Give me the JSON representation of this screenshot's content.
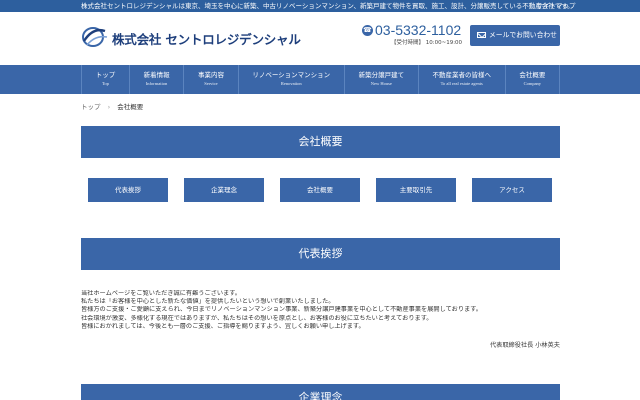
{
  "topbar": {
    "text": "株式会社セントロレジデンシャルは東京、埼玉を中心に新築、中古リノベーションマンション、新築戸建て物件を買取、施工、設計、分譲販売している不動産会社です。",
    "sitemap": "｜サイトマップ"
  },
  "header": {
    "logo_text": "株式会社 セントロレジデンシャル",
    "phone_number": "03-5332-1102",
    "phone_hours": "【受付時間】 10:00~19:00",
    "mail_button": "メールでお問い合わせ"
  },
  "colors": {
    "brand": "#3a66a8",
    "topbar": "#2d5f9e",
    "logo": "#1e3f7c"
  },
  "nav": {
    "items": [
      {
        "jp": "トップ",
        "en": "Top"
      },
      {
        "jp": "新着情報",
        "en": "Information"
      },
      {
        "jp": "事業内容",
        "en": "Service"
      },
      {
        "jp": "リノベーションマンション",
        "en": "Renovation"
      },
      {
        "jp": "新築分譲戸建て",
        "en": "New House"
      },
      {
        "jp": "不動産業者の皆様へ",
        "en": "To all real estate agents"
      },
      {
        "jp": "会社概要",
        "en": "Company"
      }
    ]
  },
  "breadcrumb": {
    "home": "トップ",
    "separator": "›",
    "current": "会社概要"
  },
  "page_title": "会社概要",
  "subnav": [
    "代表挨拶",
    "企業理念",
    "会社概要",
    "主要取引先",
    "アクセス"
  ],
  "greeting": {
    "heading": "代表挨拶",
    "lines": [
      "当社ホームページをご覧いただき誠に有難うございます。",
      "私たちは「お客様を中心とした新たな価値」を提供したいという想いで創業いたしました。",
      "皆様方のご支援・ご愛顧に支えられ、今日までリノベーションマンション事業、新築分譲戸建事業を中心として不動産事業を展開しております。",
      "社会環境が激変、多様化する現在ではありますが、私たちはその想いを原点とし、お客様のお役に立ちたいと考えております。",
      "皆様におかれましては、今後とも一層のご支援、ご指導を賜りますよう、宜しくお願い申し上げます。"
    ],
    "signature": "代表取締役社長 小林英夫"
  },
  "next_section": {
    "heading": "企業理念"
  }
}
